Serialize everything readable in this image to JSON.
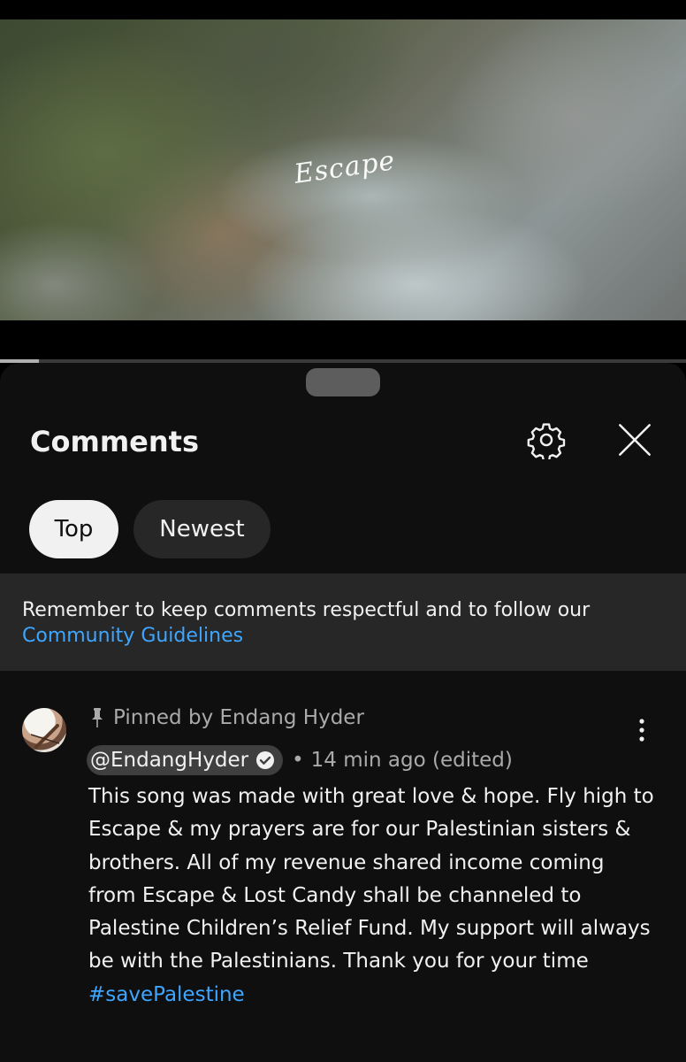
{
  "video": {
    "title_overlay": "Escape",
    "progress_fraction": 0.057
  },
  "sheet": {
    "title": "Comments",
    "settings_icon": "gear-icon",
    "close_icon": "close-icon"
  },
  "sort_chips": [
    {
      "label": "Top",
      "selected": true
    },
    {
      "label": "Newest",
      "selected": false
    }
  ],
  "notice": {
    "text": "Remember to keep comments respectful and to follow our",
    "link": "Community Guidelines"
  },
  "comment": {
    "pinned_label": "Pinned by Endang Hyder",
    "author": "@EndangHyder",
    "verified_icon": "verified-check-icon",
    "time": "14 min ago (edited)",
    "body": "This song was made with great love & hope. Fly high to Escape & my prayers are for our Palestinian sisters & brothers. All of my revenue shared income coming from Escape & Lost Candy shall be channeled to Palestine Children’s Relief Fund. My support will always be with the Palestinians. Thank you for your time",
    "hashtag": "#savePalestine",
    "more_icon": "more-vertical-icon"
  },
  "colors": {
    "background": "#0f0f0f",
    "link": "#3ea6ff",
    "chip_selected": "#f1f1f1",
    "chip": "#272727"
  }
}
